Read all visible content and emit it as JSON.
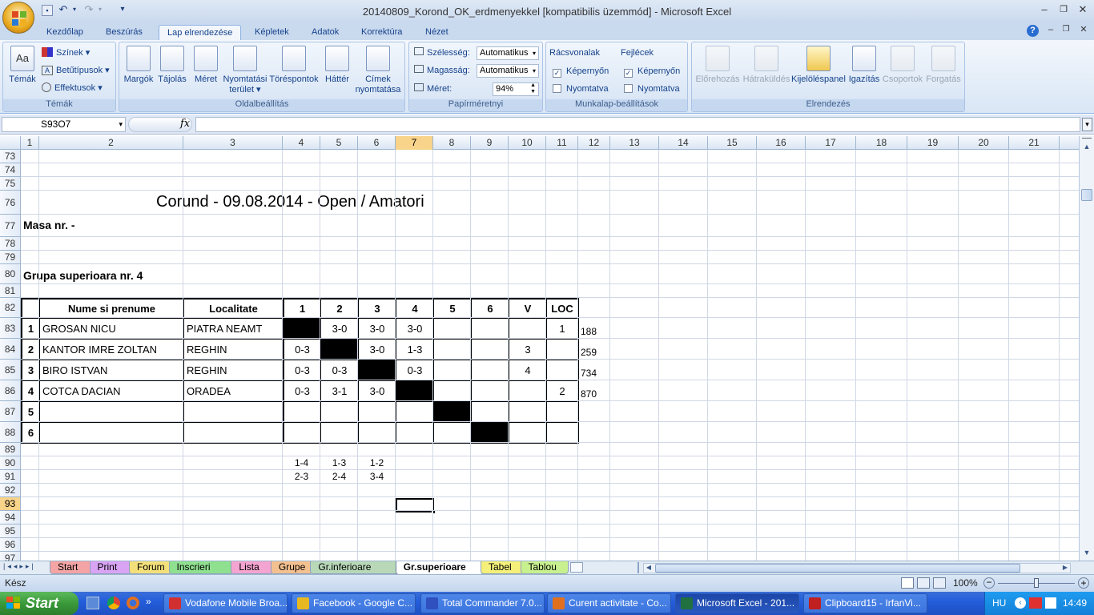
{
  "title_bar": {
    "title": "20140809_Korond_OK_erdmenyekkel  [kompatibilis üzemmód] - Microsoft Excel"
  },
  "ribbon": {
    "tabs": [
      "Kezdőlap",
      "Beszúrás",
      "Lap elrendezése",
      "Képletek",
      "Adatok",
      "Korrektúra",
      "Nézet"
    ],
    "active_tab": "Lap elrendezése",
    "groups": {
      "temak": {
        "label": "Témák",
        "themes_button": "Témák",
        "colors": "Színek",
        "fonts": "Betűtípusok",
        "effects": "Effektusok"
      },
      "page_setup": {
        "label": "Oldalbeállítás",
        "margins": "Margók",
        "orientation": "Tájolás",
        "size": "Méret",
        "print_area": [
          "Nyomtatási",
          "terület"
        ],
        "breaks": "Töréspontok",
        "background": "Háttér",
        "print_titles": [
          "Címek",
          "nyomtatása"
        ]
      },
      "scale": {
        "label": "Papírméretnyi",
        "width_label": "Szélesség:",
        "width_value": "Automatikus",
        "height_label": "Magasság:",
        "height_value": "Automatikus",
        "scale_label": "Méret:",
        "scale_value": "94%"
      },
      "sheet_options": {
        "label": "Munkalap-beállítások",
        "gridlines": "Rácsvonalak",
        "headings": "Fejlécek",
        "view": "Képernyőn",
        "print": "Nyomtatva",
        "gridlines_view_checked": true,
        "gridlines_print_checked": false,
        "headings_view_checked": true,
        "headings_print_checked": false
      },
      "arrange": {
        "label": "Elrendezés",
        "bring_forward": "Előrehozás",
        "send_backward": "Hátraküldés",
        "selection_pane": "Kijelöléspanel",
        "align": "Igazítás",
        "group": "Csoportok",
        "rotate": "Forgatás"
      }
    }
  },
  "formula_bar": {
    "name_box": "S93O7",
    "fx": "fx",
    "content": ""
  },
  "columns": [
    "1",
    "2",
    "3",
    "4",
    "5",
    "6",
    "7",
    "8",
    "9",
    "10",
    "11",
    "12",
    "13",
    "14",
    "15",
    "16",
    "17",
    "18",
    "19",
    "20",
    "21"
  ],
  "selected_column": "7",
  "rows": [
    "73",
    "74",
    "75",
    "76",
    "77",
    "78",
    "79",
    "80",
    "81",
    "82",
    "83",
    "84",
    "85",
    "86",
    "87",
    "88",
    "89",
    "90",
    "91",
    "92",
    "93",
    "94",
    "95",
    "96",
    "97"
  ],
  "selected_row": "93",
  "sheet": {
    "heading": "Corund - 09.08.2014 - Open / Amatori",
    "masa": "Masa nr.  -",
    "group": "Grupa superioara nr. 4",
    "table_headers": [
      "",
      "Nume si prenume",
      "Localitate",
      "1",
      "2",
      "3",
      "4",
      "5",
      "6",
      "V",
      "LOC"
    ],
    "table_rows": [
      [
        "1",
        "GROSAN NICU",
        "PIATRA NEAMT",
        "",
        "3-0",
        "3-0",
        "3-0",
        "",
        "",
        "",
        "1"
      ],
      [
        "2",
        "KANTOR IMRE ZOLTAN",
        "REGHIN",
        "0-3",
        "",
        "3-0",
        "1-3",
        "",
        "",
        "3",
        ""
      ],
      [
        "3",
        "BIRO ISTVAN",
        "REGHIN",
        "0-3",
        "0-3",
        "",
        "0-3",
        "",
        "",
        "4",
        ""
      ],
      [
        "4",
        "COTCA DACIAN",
        "ORADEA",
        "0-3",
        "3-1",
        "3-0",
        "",
        "",
        "",
        "",
        "2"
      ],
      [
        "5",
        "",
        "",
        "",
        "",
        "",
        "",
        "",
        "",
        "",
        ""
      ],
      [
        "6",
        "",
        "",
        "",
        "",
        "",
        "",
        "",
        "",
        "",
        ""
      ]
    ],
    "side_values": [
      "188",
      "259",
      "734",
      "870"
    ],
    "round_row1": [
      "1-4",
      "1-3",
      "1-2"
    ],
    "round_row2": [
      "2-3",
      "2-4",
      "3-4"
    ]
  },
  "sheet_tabs": [
    {
      "label": "Start",
      "color": "#f4a4a4"
    },
    {
      "label": "Print",
      "color": "#d9a4f4"
    },
    {
      "label": "Forum",
      "color": "#f4e07a"
    },
    {
      "label": "Inscrieri",
      "color": "#8fe08f"
    },
    {
      "label": "Lista",
      "color": "#f4a4d0"
    },
    {
      "label": "Grupe",
      "color": "#f4c08f"
    },
    {
      "label": "Gr.inferioare",
      "color": "#b8d8b8"
    },
    {
      "label": "Gr.superioare",
      "color": "#ffffff"
    },
    {
      "label": "Tabel",
      "color": "#f4f07a"
    },
    {
      "label": "Tablou",
      "color": "#c8f08f"
    }
  ],
  "active_sheet": "Gr.superioare",
  "status_bar": {
    "mode": "Kész",
    "zoom": "100%"
  },
  "taskbar": {
    "start": "Start",
    "items": [
      {
        "label": "Vodafone Mobile Broa...",
        "color": "#d23030"
      },
      {
        "label": "Facebook - Google C...",
        "color": "#e8b820"
      },
      {
        "label": "Total Commander 7.0...",
        "color": "#3050c0"
      },
      {
        "label": "Curent activitate - Co...",
        "color": "#e07020"
      },
      {
        "label": "Microsoft Excel - 201...",
        "color": "#207040"
      },
      {
        "label": "Clipboard15 - IrfanVi...",
        "color": "#c02020"
      }
    ],
    "active_item": "Microsoft Excel - 201...",
    "language": "HU",
    "clock": "14:49"
  }
}
